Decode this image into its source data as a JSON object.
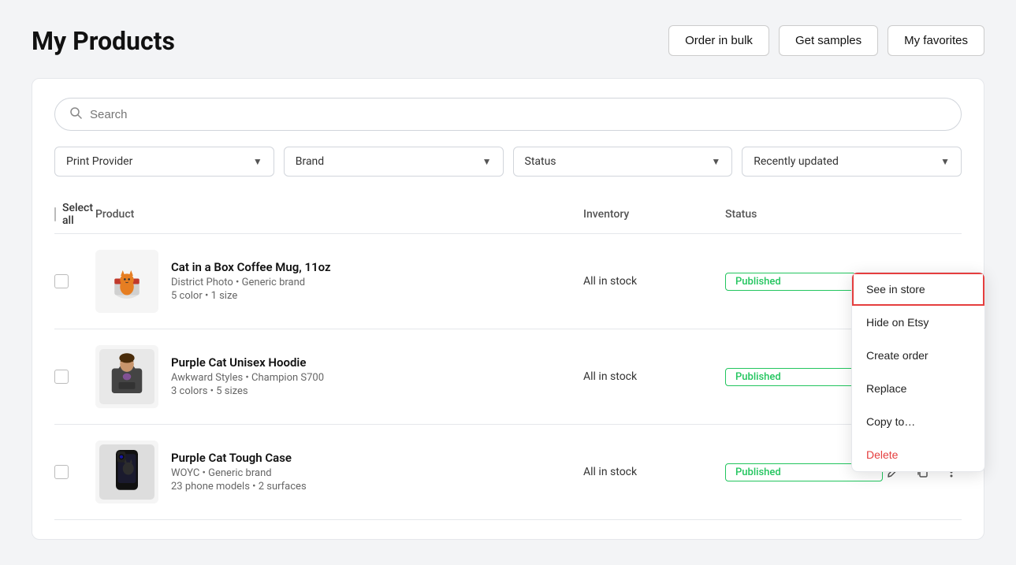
{
  "page": {
    "title": "My Products"
  },
  "header_buttons": [
    {
      "id": "order-bulk",
      "label": "Order in bulk"
    },
    {
      "id": "get-samples",
      "label": "Get samples"
    },
    {
      "id": "my-favorites",
      "label": "My favorites"
    }
  ],
  "search": {
    "placeholder": "Search"
  },
  "filters": [
    {
      "id": "print-provider",
      "label": "Print Provider"
    },
    {
      "id": "brand",
      "label": "Brand"
    },
    {
      "id": "status",
      "label": "Status"
    },
    {
      "id": "recently-updated",
      "label": "Recently updated"
    }
  ],
  "table": {
    "select_all_label": "Select all",
    "columns": [
      {
        "id": "product",
        "label": "Product"
      },
      {
        "id": "inventory",
        "label": "Inventory"
      },
      {
        "id": "status",
        "label": "Status"
      }
    ],
    "rows": [
      {
        "id": "row-1",
        "name": "Cat in a Box Coffee Mug, 11oz",
        "meta1": "District Photo • Generic brand",
        "meta2": "5 color • 1 size",
        "inventory": "All in stock",
        "status": "Published",
        "has_menu": true
      },
      {
        "id": "row-2",
        "name": "Purple Cat Unisex Hoodie",
        "meta1": "Awkward Styles • Champion S700",
        "meta2": "3 colors • 5 sizes",
        "inventory": "All in stock",
        "status": "Published",
        "has_menu": false
      },
      {
        "id": "row-3",
        "name": "Purple Cat Tough Case",
        "meta1": "WOYC • Generic brand",
        "meta2": "23 phone models • 2 surfaces",
        "inventory": "All in stock",
        "status": "Published",
        "has_menu": false
      }
    ]
  },
  "context_menu": {
    "items": [
      {
        "id": "see-in-store",
        "label": "See in store",
        "active": true,
        "delete": false
      },
      {
        "id": "hide-on-etsy",
        "label": "Hide on Etsy",
        "active": false,
        "delete": false
      },
      {
        "id": "create-order",
        "label": "Create order",
        "active": false,
        "delete": false
      },
      {
        "id": "replace",
        "label": "Replace",
        "active": false,
        "delete": false
      },
      {
        "id": "copy-to",
        "label": "Copy to…",
        "active": false,
        "delete": false
      },
      {
        "id": "delete",
        "label": "Delete",
        "active": false,
        "delete": true
      }
    ]
  },
  "icons": {
    "search": "🔍",
    "chevron_down": "▼",
    "edit": "✏",
    "copy": "⧉",
    "more": "⋮"
  },
  "colors": {
    "published_border": "#22c55e",
    "published_text": "#22c55e",
    "delete_text": "#e53e3e",
    "active_menu_outline": "#e53e3e"
  }
}
